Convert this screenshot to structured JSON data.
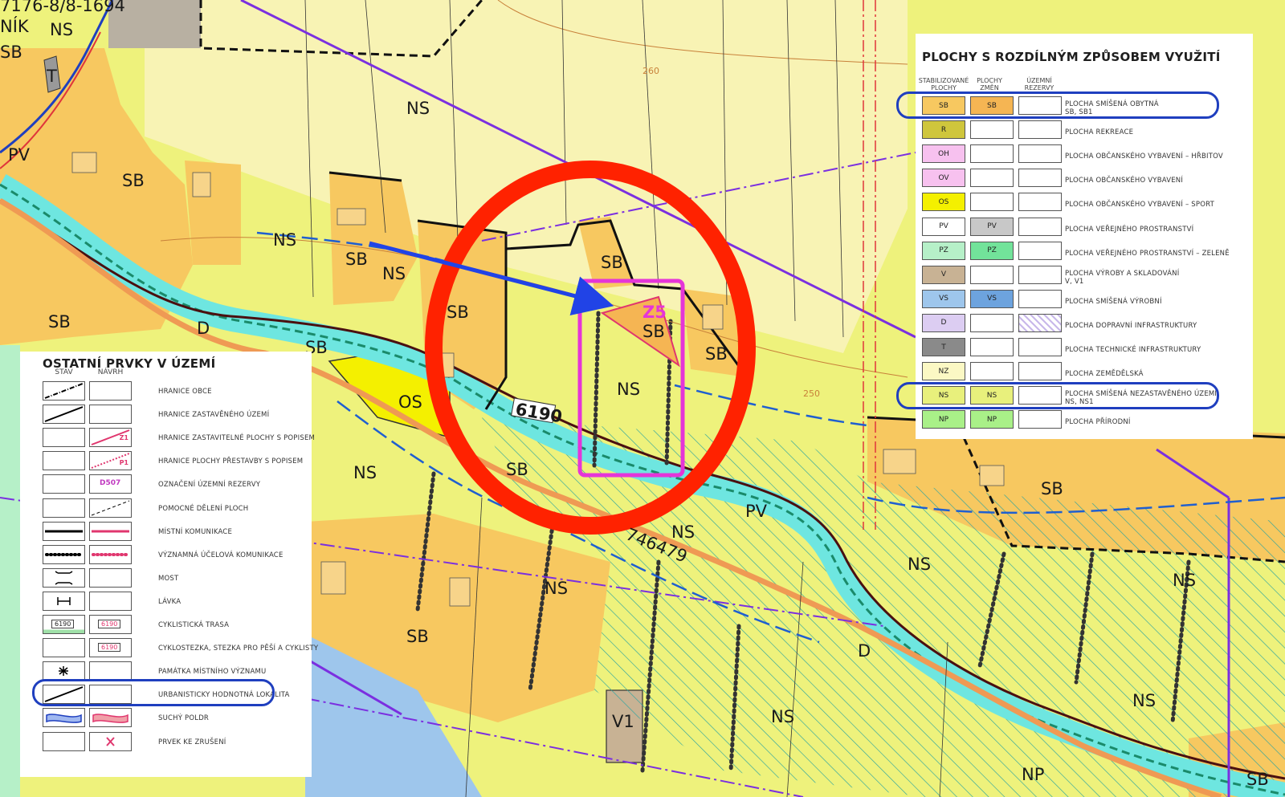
{
  "map_labels": {
    "top_left": "7176-8/8-1694",
    "nik": "NÍK",
    "ns_topleft": "NS",
    "sb_topleft": "SB",
    "t_label": "T",
    "pv_left": "PV",
    "sb_a": "SB",
    "ns_top": "NS",
    "ns_mid1": "NS",
    "sb_b": "SB",
    "ns_mid2": "NS",
    "sb_c": "SB",
    "sb_d": "SB",
    "d_left": "D",
    "sb_e": "SB",
    "sb_f": "SB",
    "os": "OS",
    "sb_g": "SB",
    "z5": "Z5",
    "sb_z5": "SB",
    "ns_z5": "NS",
    "sb_h": "SB",
    "route": "6190",
    "ns_b1": "NS",
    "sb_i": "SB",
    "pv_mid": "PV",
    "ns_b2": "NS",
    "parcel": "746479",
    "ns_b3": "NS",
    "sb_j": "SB",
    "ns_r1": "NS",
    "sb_r1": "SB",
    "ns_r2": "NS",
    "d_mid": "D",
    "v1": "V1",
    "ns_b4": "NS",
    "ns_r3": "NS",
    "np": "NP",
    "sb_corner": "SB",
    "contour_260": "260",
    "contour_250": "250"
  },
  "legend_right": {
    "title": "PLOCHY S ROZDÍLNÝM ZPŮSOBEM VYUŽITÍ",
    "col_stable": "STABILIZOVANÉ PLOCHY",
    "col_change": "PLOCHY ZMĚN",
    "col_reserve": "ÚZEMNÍ REZERVY",
    "rows": [
      {
        "code1": "SB",
        "code2": "SB",
        "c1": "#f7c860",
        "c2": "#f5b553",
        "label": "PLOCHA SMÍŠENÁ OBYTNÁ",
        "sub": "SB, SB1"
      },
      {
        "code1": "R",
        "code2": "",
        "c1": "#cfc63c",
        "c2": "",
        "label": "PLOCHA REKREACE",
        "sub": ""
      },
      {
        "code1": "OH",
        "code2": "",
        "c1": "#f7c1ef",
        "c2": "",
        "label": "PLOCHA OBČANSKÉHO VYBAVENÍ – HŘBITOV",
        "sub": ""
      },
      {
        "code1": "OV",
        "code2": "",
        "c1": "#f7c1ef",
        "c2": "",
        "label": "PLOCHA OBČANSKÉHO VYBAVENÍ",
        "sub": ""
      },
      {
        "code1": "OS",
        "code2": "",
        "c1": "#f4f000",
        "c2": "",
        "label": "PLOCHA OBČANSKÉHO VYBAVENÍ – SPORT",
        "sub": ""
      },
      {
        "code1": "PV",
        "code2": "PV",
        "c1": "#ffffff",
        "c2": "#c8c8c8",
        "label": "PLOCHA VEŘEJNÉHO PROSTRANSTVÍ",
        "sub": ""
      },
      {
        "code1": "PZ",
        "code2": "PZ",
        "c1": "#b6f0c8",
        "c2": "#72e39a",
        "label": "PLOCHA VEŘEJNÉHO PROSTRANSTVÍ – ZELENĚ",
        "sub": ""
      },
      {
        "code1": "V",
        "code2": "",
        "c1": "#c8b294",
        "c2": "",
        "label": "PLOCHA VÝROBY A SKLADOVÁNÍ",
        "sub": "V, V1"
      },
      {
        "code1": "VS",
        "code2": "VS",
        "c1": "#9ec6ec",
        "c2": "#6da3de",
        "label": "PLOCHA SMÍŠENÁ VÝROBNÍ",
        "sub": ""
      },
      {
        "code1": "D",
        "code2": "",
        "c1": "#dccdf2",
        "c2": "",
        "label": "PLOCHA DOPRAVNÍ INFRASTRUKTURY",
        "sub": ""
      },
      {
        "code1": "T",
        "code2": "",
        "c1": "#8a8a8a",
        "c2": "",
        "label": "PLOCHA TECHNICKÉ INFRASTRUKTURY",
        "sub": ""
      },
      {
        "code1": "NZ",
        "code2": "",
        "c1": "#fbf8c4",
        "c2": "",
        "label": "PLOCHA ZEMĚDĚLSKÁ",
        "sub": ""
      },
      {
        "code1": "NS",
        "code2": "NS",
        "c1": "#e8f07c",
        "c2": "#e8f07c",
        "label": "PLOCHA SMÍŠENÁ NEZASTAVĚNÉHO ÚZEMÍ",
        "sub": "NS, NS1"
      },
      {
        "code1": "NP",
        "code2": "NP",
        "c1": "#a9f088",
        "c2": "#a9f088",
        "label": "PLOCHA PŘÍRODNÍ",
        "sub": ""
      }
    ]
  },
  "legend_left": {
    "title": "OSTATNÍ PRVKY V ÚZEMÍ",
    "col_state": "STAV",
    "col_plan": "NÁVRH",
    "cyc_code": "6190",
    "z1": "Z1",
    "p1": "P1",
    "d507": "D507",
    "rows": [
      "HRANICE OBCE",
      "HRANICE ZASTAVĚNÉHO ÚZEMÍ",
      "HRANICE ZASTAVITELNÉ PLOCHY S POPISEM",
      "HRANICE PLOCHY PŘESTAVBY S POPISEM",
      "OZNAČENÍ ÚZEMNÍ REZERVY",
      "POMOCNÉ DĚLENÍ PLOCH",
      "MÍSTNÍ KOMUNIKACE",
      "VÝZNAMNÁ ÚČELOVÁ KOMUNIKACE",
      "MOST",
      "LÁVKA",
      "CYKLISTICKÁ TRASA",
      "CYKLOSTEZKA, STEZKA PRO PĚŠÍ A CYKLISTY",
      "PAMÁTKA MÍSTNÍHO VÝZNAMU",
      "URBANISTICKY HODNOTNÁ LOKALITA",
      "SUCHÝ POLDR",
      "PRVEK KE ZRUŠENÍ"
    ]
  },
  "colors": {
    "ns": "#eef27c",
    "sb": "#f7c860",
    "os": "#f4f000",
    "river": "#6ee6e0",
    "highlight_circle": "#ff2200",
    "highlight_box": "#e535d8",
    "arrow": "#2143e6",
    "boundary": "#7b2fe0"
  }
}
